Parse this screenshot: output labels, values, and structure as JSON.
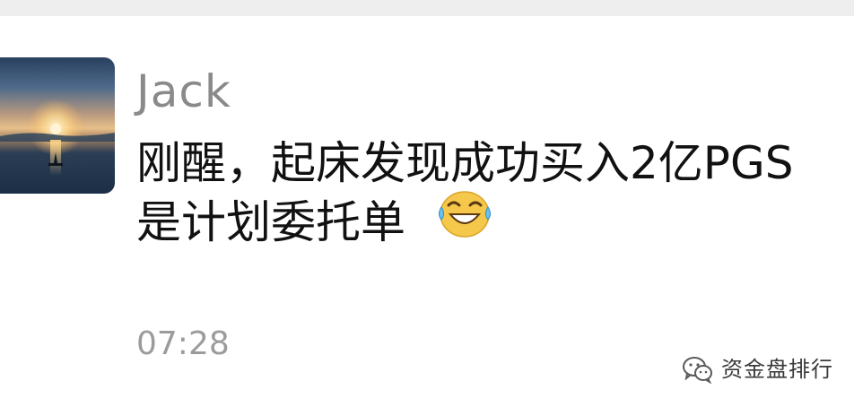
{
  "chat": {
    "sender": {
      "name": "Jack"
    },
    "message": {
      "line1": "刚醒，起床发现成功买入2亿PGS",
      "line2": "是计划委托单",
      "emoji": "face-with-tears-of-joy-icon"
    },
    "time": "07:28"
  },
  "watermark": {
    "text": "资金盘排行",
    "icon": "wechat-icon"
  },
  "colors": {
    "name": "#8a8a8a",
    "message": "#111111",
    "time": "#9b9b9b",
    "background": "#ffffff",
    "emoji": "#f5c84c"
  }
}
